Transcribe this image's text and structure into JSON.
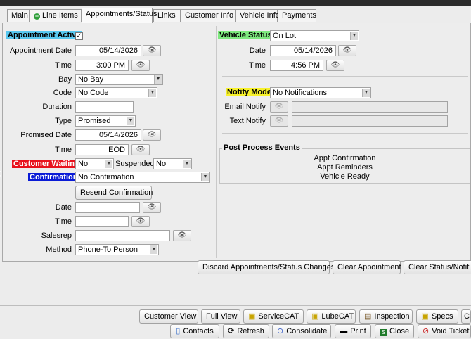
{
  "colors": {
    "appointment_active_bg": "#58c8f0",
    "vehicle_status_bg": "#7ee87e",
    "notify_mode_bg": "#f7f12a",
    "customer_waiting_bg": "#e8121d",
    "confirmation_bg": "#0a1bd6"
  },
  "tabs": [
    {
      "label": "Main"
    },
    {
      "label": "Line Items",
      "icon": "plus-circle-icon"
    },
    {
      "label": "Appointments/Status"
    },
    {
      "label": "Links"
    },
    {
      "label": "Customer Info"
    },
    {
      "label": "Vehicle Info"
    },
    {
      "label": "Payments"
    }
  ],
  "left": {
    "appointment_active_label": "Appointment Active",
    "appointment_active_checked": true,
    "appointment_date_label": "Appointment Date",
    "appointment_date_value": "05/14/2026",
    "time_label": "Time",
    "appointment_time_value": "3:00 PM",
    "bay_label": "Bay",
    "bay_value": "No Bay",
    "code_label": "Code",
    "code_value": "No Code",
    "duration_label": "Duration",
    "duration_value": "",
    "type_label": "Type",
    "type_value": "Promised",
    "promised_date_label": "Promised Date",
    "promised_date_value": "05/14/2026",
    "promised_time_value": "EOD",
    "customer_waiting_label": "Customer Waiting",
    "customer_waiting_value": "No",
    "suspended_label": "Suspended",
    "suspended_value": "No",
    "confirmation_label": "Confirmation",
    "confirmation_value": "No Confirmation",
    "resend_confirmation_label": "Resend Confirmation",
    "date_label": "Date",
    "confirm_date_value": "",
    "confirm_time_value": "",
    "salesrep_label": "Salesrep",
    "salesrep_value": "",
    "method_label": "Method",
    "method_value": "Phone-To Person"
  },
  "right": {
    "vehicle_status_label": "Vehicle Status",
    "vehicle_status_value": "On Lot",
    "date_label": "Date",
    "date_value": "05/14/2026",
    "time_label": "Time",
    "time_value": "4:56 PM",
    "notify_mode_label": "Notify Mode",
    "notify_mode_value": "No Notifications",
    "email_notify_label": "Email Notify",
    "email_notify_value": "",
    "text_notify_label": "Text Notify",
    "text_notify_value": "",
    "post_process_title": "Post Process Events",
    "post_process_events": [
      "Appt Confirmation",
      "Appt Reminders",
      "Vehicle Ready"
    ]
  },
  "actions": {
    "discard": "Discard Appointments/Status Changes",
    "clear_appointment": "Clear Appointment",
    "clear_status": "Clear Status/Notifica"
  },
  "bottom_row1": [
    {
      "label": "Customer View"
    },
    {
      "label": "Full View"
    },
    {
      "label": "ServiceCAT",
      "icon": "servicecat-icon"
    },
    {
      "label": "LubeCAT",
      "icon": "lubecat-icon"
    },
    {
      "label": "Inspection",
      "icon": "inspection-icon"
    },
    {
      "label": "Specs",
      "icon": "specs-icon"
    },
    {
      "label": "C"
    }
  ],
  "bottom_row2": [
    {
      "label": "Contacts",
      "icon": "contacts-icon"
    },
    {
      "label": "Refresh",
      "icon": "refresh-icon"
    },
    {
      "label": "Consolidate",
      "icon": "consolidate-icon"
    },
    {
      "label": "Print",
      "icon": "print-icon"
    },
    {
      "label": "Close",
      "icon": "close-icon"
    },
    {
      "label": "Void Ticket",
      "icon": "void-icon"
    }
  ]
}
